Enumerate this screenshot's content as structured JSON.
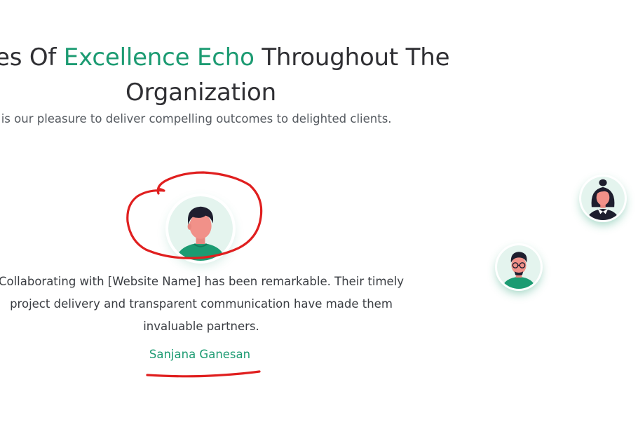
{
  "heading": {
    "line1_prefix": "es Of ",
    "line1_accent": "Excellence Echo",
    "line1_suffix": " Throughout The",
    "line2": "Organization"
  },
  "subtitle": "t is our pleasure to deliver compelling outcomes to delighted clients.",
  "testimonial": {
    "quote": "Collaborating with [Website Name] has been remarkable. Their timely project delivery and transparent communication have made them invaluable partners.",
    "author": "Sanjana Ganesan"
  },
  "avatars": [
    {
      "icon": "man-avatar-icon",
      "state": "active"
    },
    {
      "icon": "woman-avatar-icon",
      "state": "inactive"
    },
    {
      "icon": "man-glasses-avatar-icon",
      "state": "inactive"
    }
  ],
  "colors": {
    "accent": "#1c9b72",
    "heading_text": "#2f2f33",
    "body_text": "#3a3d42",
    "annotation": "#e01f1f"
  }
}
